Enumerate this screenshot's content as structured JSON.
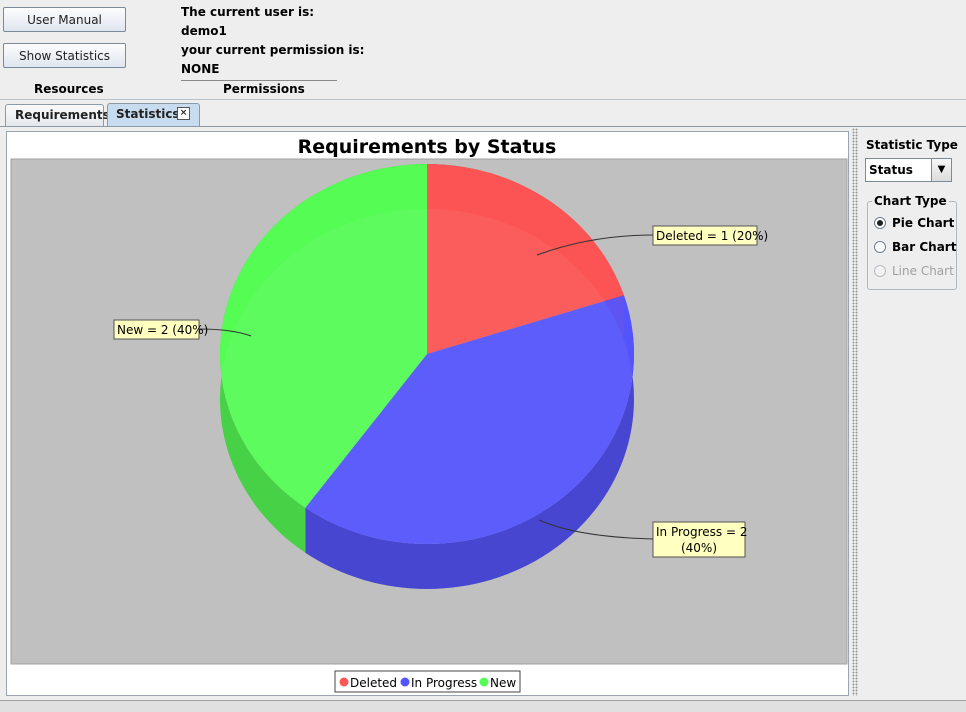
{
  "toolbar": {
    "user_manual": "User Manual",
    "show_statistics": "Show Statistics",
    "resources_label": "Resources",
    "user_label": "The current user is:",
    "user_name": "demo1",
    "permission_label": "your current permission is:",
    "permission_value": "NONE",
    "permissions_label": "Permissions"
  },
  "tabs": [
    {
      "label": "Requirements",
      "active": false
    },
    {
      "label": "Statistics",
      "active": true,
      "close": "×"
    }
  ],
  "sidebar": {
    "statistic_type_label": "Statistic Type",
    "statistic_type_value": "Status",
    "chart_type_label": "Chart Type",
    "options": [
      {
        "label": "Pie Chart",
        "selected": true,
        "enabled": true
      },
      {
        "label": "Bar Chart",
        "selected": false,
        "enabled": true
      },
      {
        "label": "Line Chart",
        "selected": false,
        "enabled": false
      }
    ]
  },
  "chart_data": {
    "type": "pie",
    "title": "Requirements by Status",
    "style": "3d",
    "slices": [
      {
        "label": "Deleted",
        "value": 1,
        "percent": 20,
        "color": "#ff5555",
        "annotation": "Deleted = 1 (20%)"
      },
      {
        "label": "In Progress",
        "value": 2,
        "percent": 40,
        "color": "#5555ff",
        "annotation_line1": "In Progress = 2",
        "annotation_line2": "(40%)"
      },
      {
        "label": "New",
        "value": 2,
        "percent": 40,
        "color": "#55ff55",
        "annotation": "New = 2 (40%)"
      }
    ],
    "legend": [
      "Deleted",
      "In Progress",
      "New"
    ],
    "legend_position": "bottom",
    "background": "#c0c0c0"
  }
}
